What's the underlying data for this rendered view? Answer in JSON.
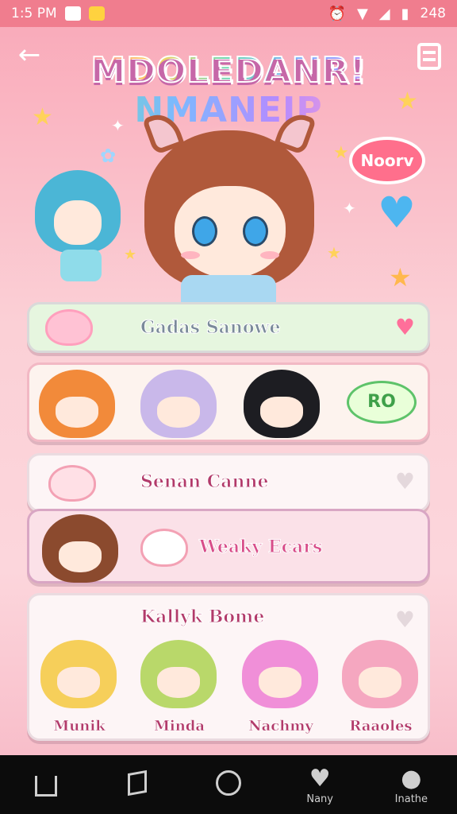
{
  "status_bar": {
    "time": "1:5 PM",
    "battery": "248"
  },
  "header": {
    "logo_line1": "MDOLEDANR!",
    "logo_line2": "NMANEIP"
  },
  "hero": {
    "speech_bubble": "Noorv"
  },
  "cards": {
    "card1_title": "Gadas Sanowe",
    "card2_button": "RO",
    "card3_title": "Senan Canne",
    "card4_title": "Weaky Ecars",
    "card5_title": "Kallyk Bome",
    "card5_names": [
      "Munik",
      "Minda",
      "Nachmy",
      "Raaoles"
    ]
  },
  "nav": {
    "item4_label": "Nany",
    "item5_label": "Inathe"
  },
  "colors": {
    "accent_pink": "#f07d8e",
    "card_green": "#e6f6df",
    "card_pink": "#fbe1e8"
  }
}
